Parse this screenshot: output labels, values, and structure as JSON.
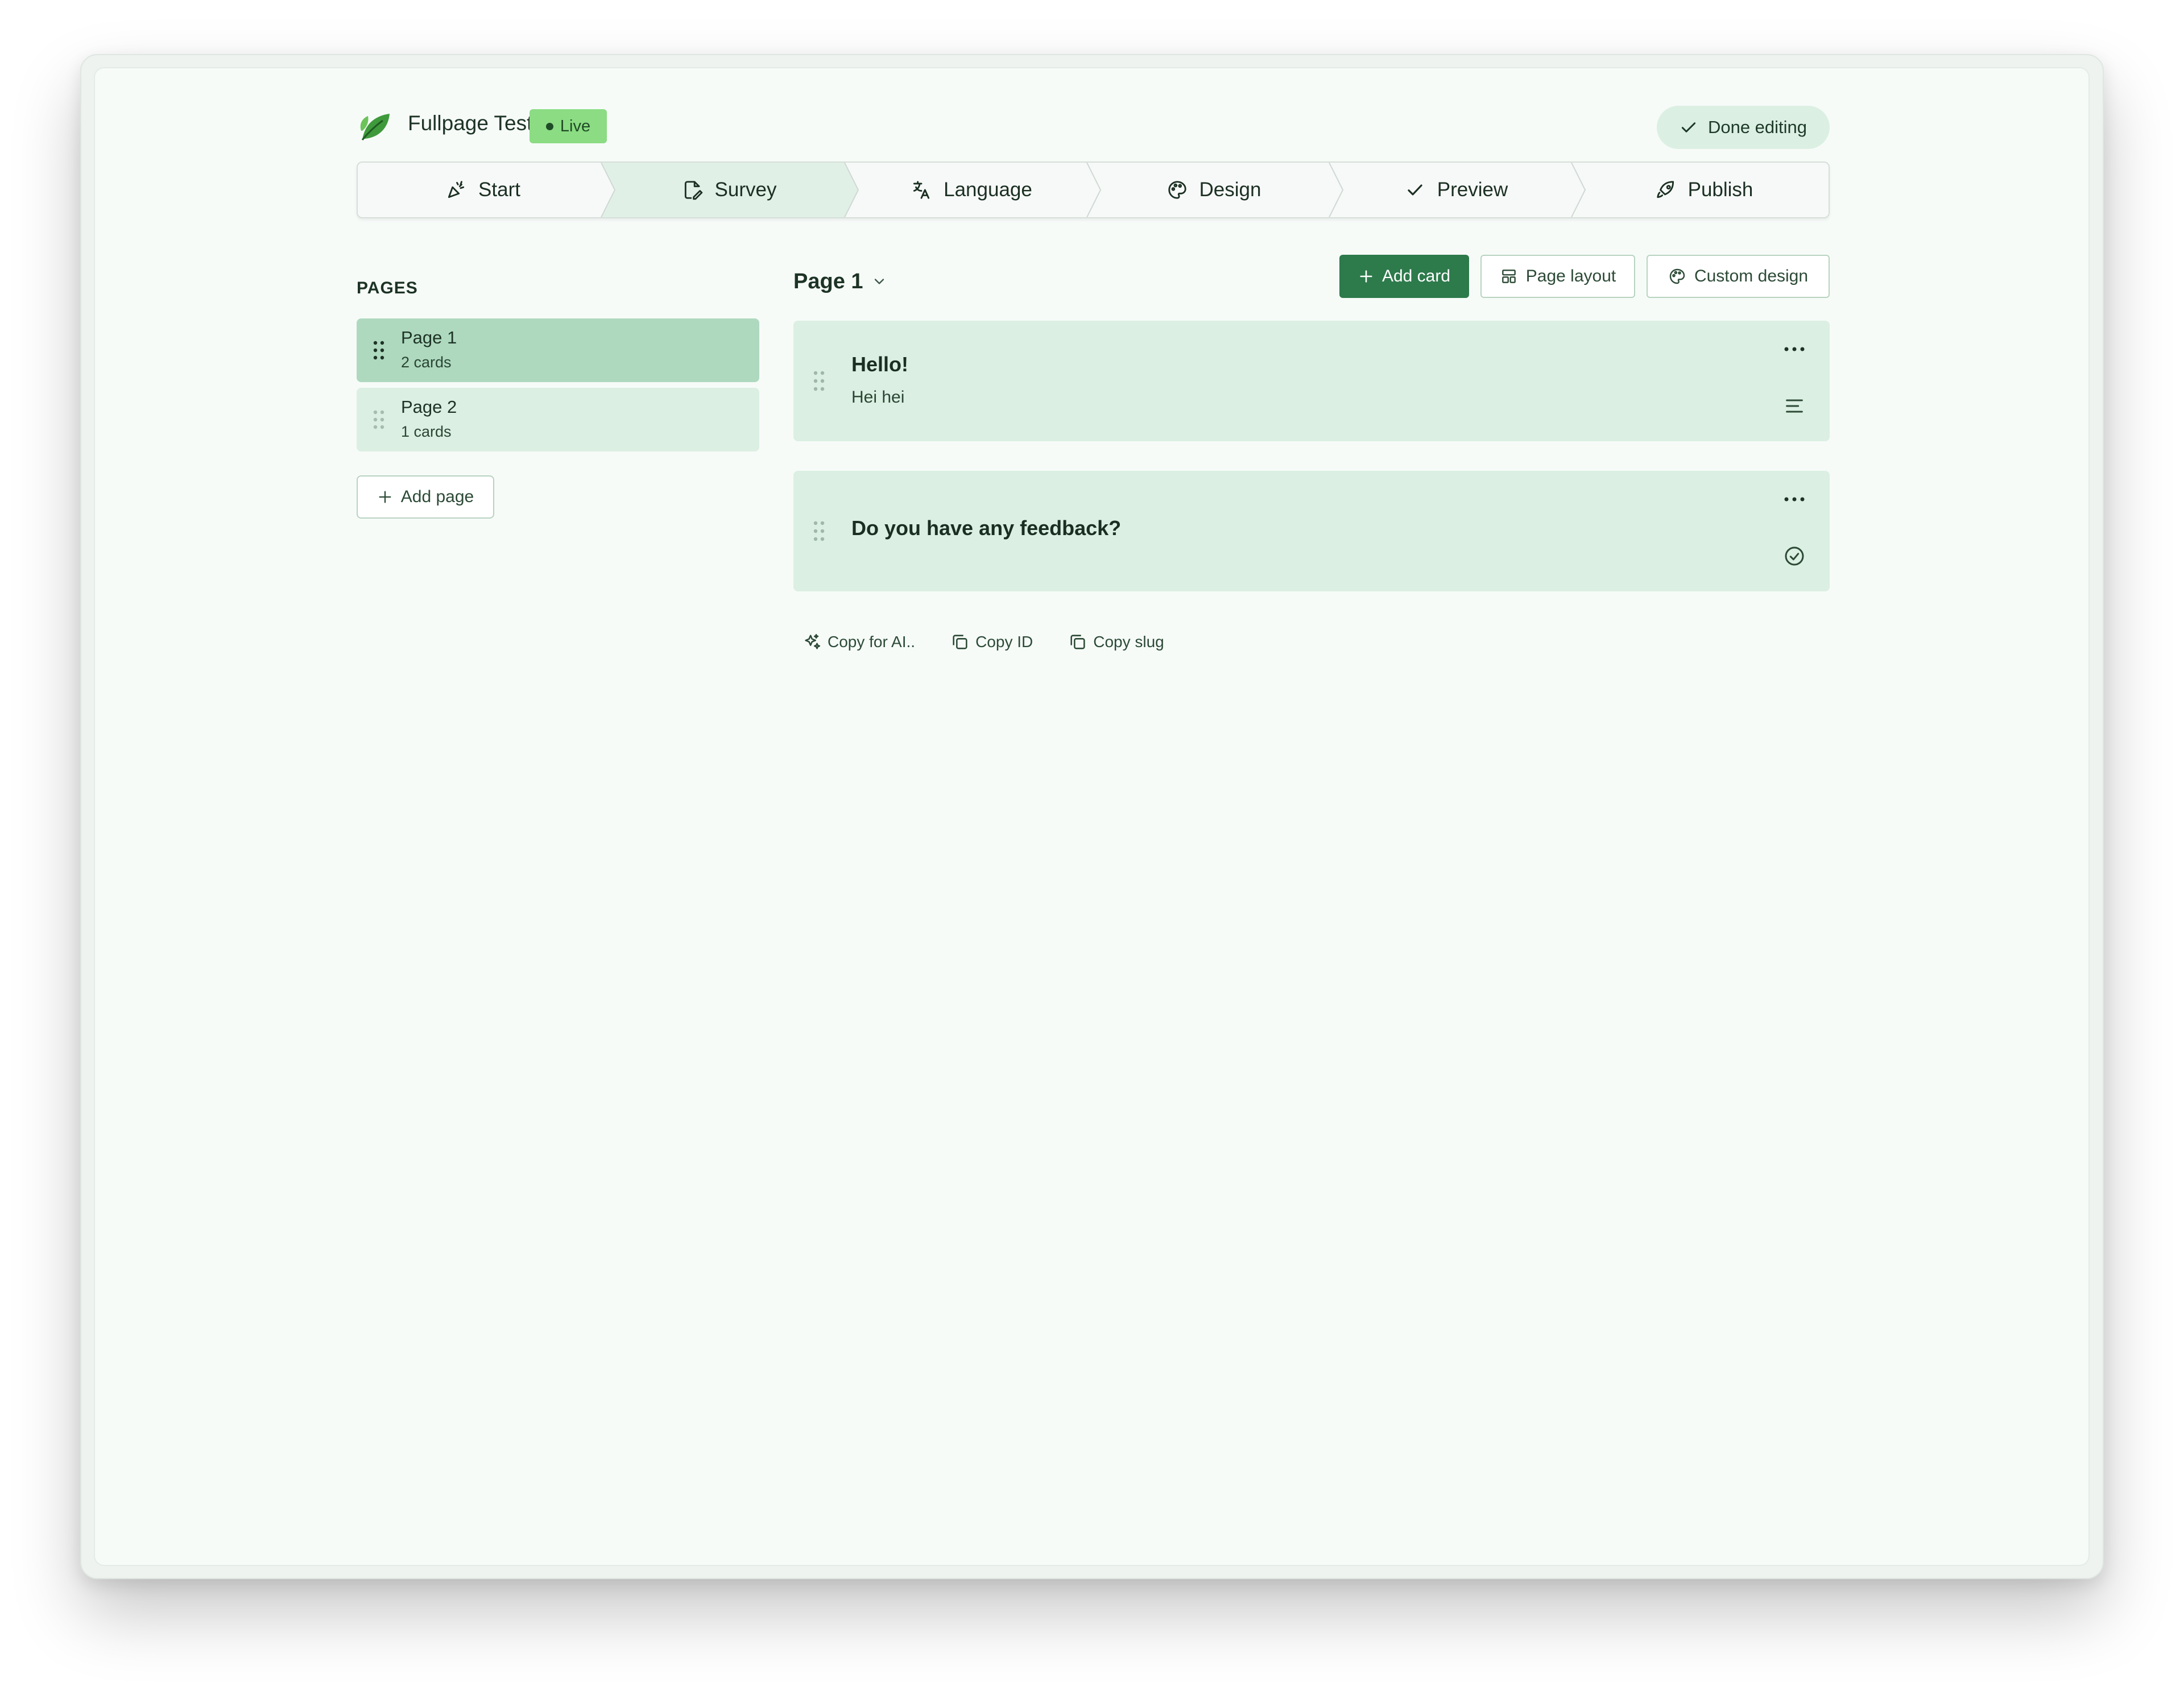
{
  "app": {
    "title": "Fullpage Test",
    "status_badge": "Live",
    "done_label": "Done editing"
  },
  "stepper": {
    "steps": [
      {
        "label": "Start",
        "icon": "party-popper-icon"
      },
      {
        "label": "Survey",
        "icon": "file-edit-icon",
        "active": true
      },
      {
        "label": "Language",
        "icon": "translate-icon"
      },
      {
        "label": "Design",
        "icon": "palette-icon"
      },
      {
        "label": "Preview",
        "icon": "check-icon"
      },
      {
        "label": "Publish",
        "icon": "rocket-icon"
      }
    ]
  },
  "sidebar": {
    "heading": "PAGES",
    "pages": [
      {
        "name": "Page 1",
        "count": "2 cards",
        "active": true
      },
      {
        "name": "Page 2",
        "count": "1 cards",
        "active": false
      }
    ],
    "add_page_label": "Add page"
  },
  "main": {
    "page_selector": "Page 1",
    "toolbar": {
      "add_card": "Add card",
      "page_layout": "Page layout",
      "custom_design": "Custom design"
    },
    "cards": [
      {
        "title": "Hello!",
        "subtitle": "Hei hei",
        "type_icon": "text-lines-icon"
      },
      {
        "title": "Do you have any feedback?",
        "subtitle": "",
        "type_icon": "check-circle-icon"
      }
    ],
    "copy_actions": {
      "copy_ai": "Copy for AI..",
      "copy_id": "Copy ID",
      "copy_slug": "Copy slug"
    }
  },
  "colors": {
    "accent": "#2d7a4b",
    "live_badge": "#8bdc83",
    "card_bg": "#dbefe2",
    "active_page_bg": "#aed9bf",
    "active_step_bg": "#e1f0e7"
  }
}
